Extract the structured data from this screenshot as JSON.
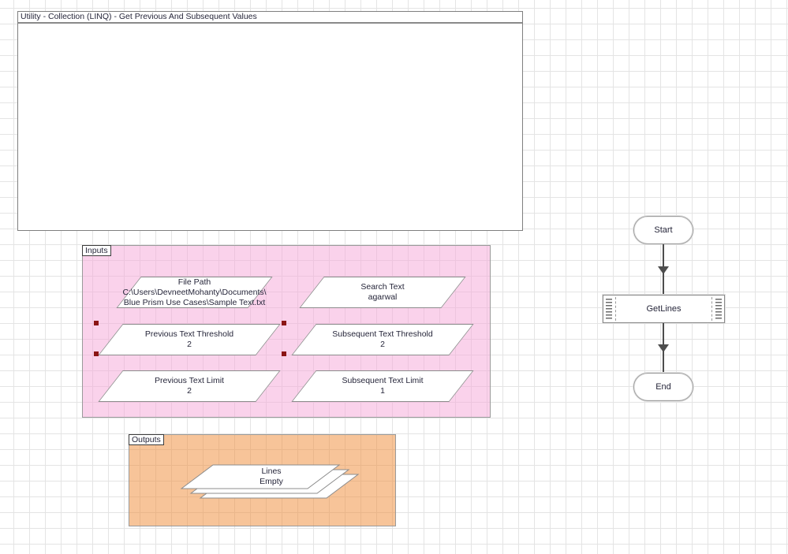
{
  "process_box": {
    "title": "Utility - Collection (LINQ) - Get Previous And Subsequent Values"
  },
  "inputs_group": {
    "label": "Inputs",
    "items": [
      {
        "label": "File Path",
        "value1": "C:\\Users\\DevneetMohanty\\Documents\\",
        "value2": "Blue Prism Use Cases\\Sample Text.txt",
        "selected": false
      },
      {
        "label": "Search Text",
        "value1": "agarwal",
        "selected": false
      },
      {
        "label": "Previous Text Threshold",
        "value1": "2",
        "selected": true
      },
      {
        "label": "Subsequent Text Threshold",
        "value1": "2",
        "selected": false
      },
      {
        "label": "Previous Text Limit",
        "value1": "2",
        "selected": false
      },
      {
        "label": "Subsequent Text Limit",
        "value1": "1",
        "selected": false
      }
    ]
  },
  "outputs_group": {
    "label": "Outputs",
    "collection": {
      "name": "Lines",
      "value": "Empty"
    }
  },
  "flow": {
    "start_label": "Start",
    "subprocess_label": "GetLines",
    "end_label": "End"
  },
  "colors": {
    "inputs_fill": "#f6a6d7",
    "outputs_fill": "#f08a34",
    "selection_handle": "#8b1515",
    "shape_border": "#8c8c8c",
    "link_line": "#4d4d4d",
    "grid_line": "#e4e4e4"
  }
}
